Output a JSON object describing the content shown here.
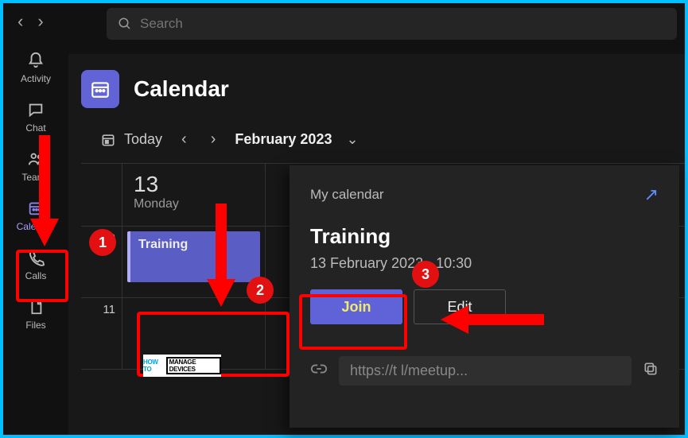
{
  "search": {
    "placeholder": "Search"
  },
  "sidebar": {
    "items": [
      {
        "label": "Activity"
      },
      {
        "label": "Chat"
      },
      {
        "label": "Teams"
      },
      {
        "label": "Calendar"
      },
      {
        "label": "Calls"
      },
      {
        "label": "Files"
      }
    ]
  },
  "calendar": {
    "title": "Calendar",
    "today_label": "Today",
    "month_label": "February 2023",
    "day": {
      "num": "13",
      "name": "Monday"
    },
    "hours": [
      "10",
      "11"
    ],
    "event": {
      "title": "Training"
    }
  },
  "popup": {
    "breadcrumb": "My calendar",
    "title": "Training",
    "time_line": "13 February 2023           - 10:30",
    "join_label": "Join",
    "edit_label": "Edit",
    "link_text": "https://t                                    l/meetup..."
  },
  "annotations": {
    "n1": "1",
    "n2": "2",
    "n3": "3"
  },
  "watermark": {
    "p1": "HOW TO",
    "p2": "MANAGE DEVICES"
  }
}
